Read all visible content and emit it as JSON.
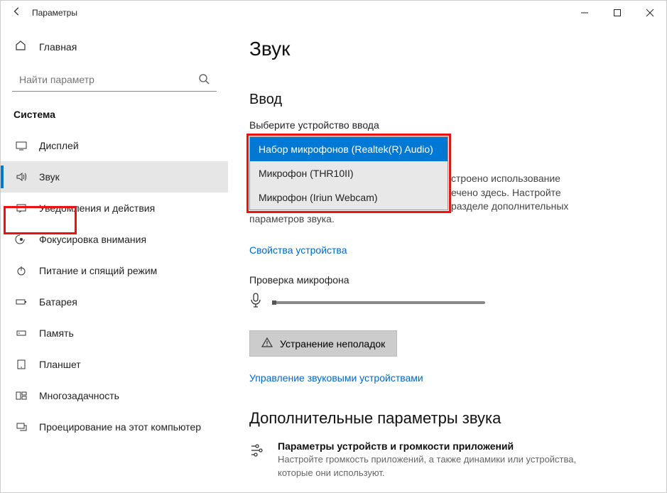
{
  "window": {
    "title": "Параметры"
  },
  "sidebar": {
    "home": "Главная",
    "search_placeholder": "Найти параметр",
    "group": "Система",
    "items": [
      {
        "label": "Дисплей"
      },
      {
        "label": "Звук"
      },
      {
        "label": "Уведомления и действия"
      },
      {
        "label": "Фокусировка внимания"
      },
      {
        "label": "Питание и спящий режим"
      },
      {
        "label": "Батарея"
      },
      {
        "label": "Память"
      },
      {
        "label": "Планшет"
      },
      {
        "label": "Многозадачность"
      },
      {
        "label": "Проецирование на этот компьютер"
      }
    ]
  },
  "main": {
    "title": "Звук",
    "input_section": "Ввод",
    "choose_device_label": "Выберите устройство ввода",
    "dropdown": {
      "options": [
        "Набор микрофонов (Realtek(R) Audio)",
        "Микрофон (THR10II)",
        "Микрофон (Iriun Webcam)"
      ]
    },
    "hint_partial_1": "строено использование",
    "hint_partial_2": "ечено здесь. Настройте",
    "hint_partial_3": "разделе дополнительных",
    "hint_partial_4": "параметров звука.",
    "device_properties_link": "Свойства устройства",
    "test_mic_label": "Проверка микрофона",
    "troubleshoot_button": "Устранение неполадок",
    "manage_devices_link": "Управление звуковыми устройствами",
    "advanced_title": "Дополнительные параметры звука",
    "app_volume_title": "Параметры устройств и громкости приложений",
    "app_volume_desc": "Настройте громкость приложений, а также динамики или устройства, которые они используют."
  }
}
